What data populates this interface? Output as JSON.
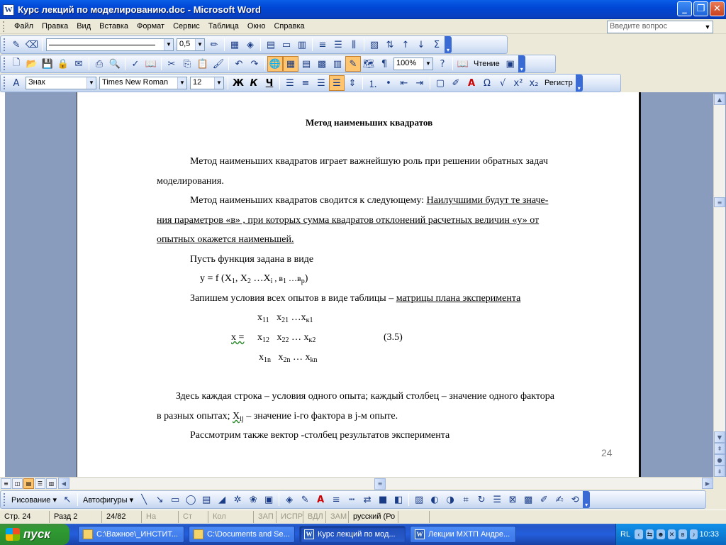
{
  "window": {
    "title": "Курс лекций по моделированию.doc - Microsoft Word"
  },
  "menu": {
    "items": [
      "Файл",
      "Правка",
      "Вид",
      "Вставка",
      "Формат",
      "Сервис",
      "Таблица",
      "Окно",
      "Справка"
    ],
    "help_placeholder": "Введите вопрос"
  },
  "toolbars": {
    "line_weight": "0,5",
    "zoom": "100%",
    "reading_label": "Чтение",
    "style": "Знак",
    "font": "Times New Roman",
    "size": "12",
    "bold_label": "Ж",
    "italic_label": "К",
    "underline_label": "Ч",
    "case_label": "Регистр"
  },
  "document": {
    "heading": "Метод наименьших квадратов",
    "p1a": "Метод наименьших квадратов играет важнейшую роль при решении обратных задач",
    "p1b": "моделирования.",
    "p2a_plain": "Метод наименьших  квадратов сводится к следующему:  ",
    "p2a_ul": "Наилучшими будут те значе-",
    "p2b_ul": "ния параметров  «в» , при которых сумма квадратов отклонений расчетных величин  «у» от",
    "p2c_ul": "опытных окажется наименьшей.",
    "p3": "Пусть  функция задана в виде",
    "formula": {
      "y_f": "у = f (X",
      "s1": "1",
      "c1": ", X",
      "s2": "2",
      "dots": " …X",
      "si": "i",
      "b1": " , в",
      "sb1": "1",
      "bp": " …в",
      "sbp": "р",
      "close": ")"
    },
    "p4_plain": "Запишем условия всех опытов в виде таблицы – ",
    "p4_ul": "матрицы плана эксперимента",
    "matrix": {
      "label": "х =",
      "r1": [
        "x",
        "11",
        "x",
        "21",
        " …x",
        "к1"
      ],
      "r2": [
        "x",
        "12",
        "x",
        "22",
        " … x",
        "к2"
      ],
      "r3": [
        "x",
        "1n",
        "x",
        "2n",
        " … x",
        "kn"
      ],
      "eq_number": "(3.5)"
    },
    "p5a": "Здесь каждая строка – условия одного опыта; каждый столбец – значение одного фактора",
    "p5b_pre": "в разных опытах; ",
    "p5b_x": "X",
    "p5b_sub": "ij",
    "p5b_post": " – значение  i-го фактора в j-м опыте.",
    "p6": "Рассмотрим также вектор -столбец результатов эксперимента",
    "page_number": "24"
  },
  "drawing_toolbar": {
    "draw_label": "Рисование ▾",
    "autoshapes_label": "Автофигуры ▾"
  },
  "status": {
    "page": "Стр.  24",
    "section": "Разд  2",
    "pages": "24/82",
    "at": "На",
    "line": "Ст",
    "col": "Кол",
    "rec": "ЗАП",
    "trk": "ИСПР",
    "ext": "ВДЛ",
    "ovr": "ЗАМ",
    "lang": "русский (Ро"
  },
  "taskbar": {
    "start_label": "пуск",
    "items": [
      "C:\\Важное\\_ИНСТИТ...",
      "C:\\Documents and Se...",
      "Курс лекций по мод...",
      "Лекции МХТП Андре..."
    ],
    "lang": "RL",
    "clock": "10:33"
  }
}
